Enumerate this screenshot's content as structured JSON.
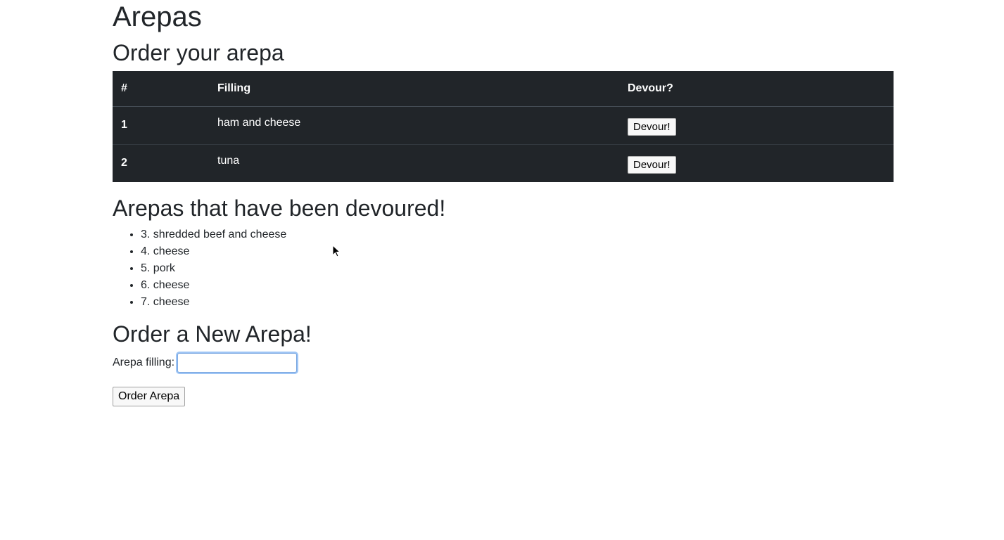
{
  "page": {
    "title": "Arepas"
  },
  "order_section": {
    "heading": "Order your arepa",
    "columns": [
      "#",
      "Filling",
      "Devour?"
    ],
    "rows": [
      {
        "id": "1",
        "filling": "ham and cheese",
        "action": "Devour!"
      },
      {
        "id": "2",
        "filling": "tuna",
        "action": "Devour!"
      }
    ]
  },
  "devoured_section": {
    "heading": "Arepas that have been devoured!",
    "items": [
      "3. shredded beef and cheese",
      "4. cheese",
      "5. pork",
      "6. cheese",
      "7. cheese"
    ]
  },
  "new_order": {
    "heading": "Order a New Arepa!",
    "label": "Arepa filling:",
    "input_value": "",
    "button_label": "Order Arepa"
  },
  "icons": {
    "cursor": "mouse-pointer-icon"
  },
  "colors": {
    "table_bg": "#212529",
    "focus_ring": "#9ec5f5"
  }
}
